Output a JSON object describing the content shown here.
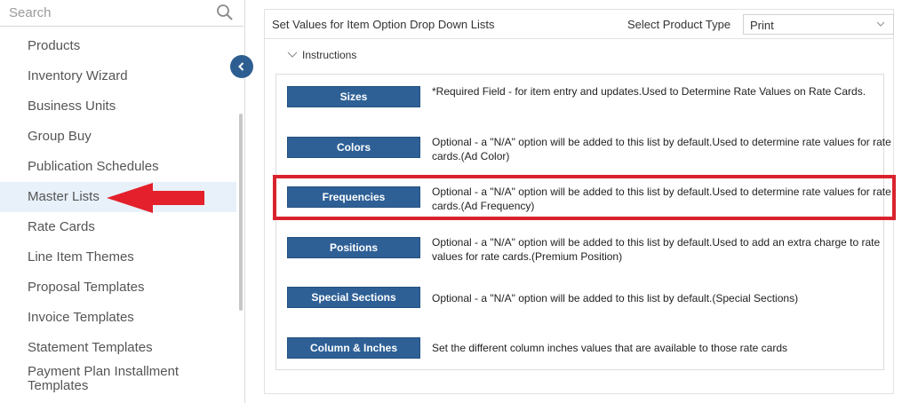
{
  "search": {
    "placeholder": "Search",
    "icon": "search-icon"
  },
  "sidebar": {
    "collapse_icon": "chevron-left-icon",
    "active_color": "#e8f1fa",
    "items": [
      {
        "label": "Products"
      },
      {
        "label": "Inventory Wizard"
      },
      {
        "label": "Business Units"
      },
      {
        "label": "Group Buy"
      },
      {
        "label": "Publication Schedules"
      },
      {
        "label": "Master Lists",
        "active": true
      },
      {
        "label": "Rate Cards"
      },
      {
        "label": "Line Item Themes"
      },
      {
        "label": "Proposal Templates"
      },
      {
        "label": "Invoice Templates"
      },
      {
        "label": "Statement Templates"
      },
      {
        "label": "Payment Plan Installment Templates"
      }
    ]
  },
  "annotation": {
    "arrow_color": "#e3202b",
    "highlight_color": "#d9232c"
  },
  "main": {
    "title": "Set Values for Item Option Drop Down Lists",
    "product_type_label": "Select Product Type",
    "product_type_value": "Print",
    "instructions_label": "Instructions",
    "button_color": "#2e6096",
    "rows": [
      {
        "button": "Sizes",
        "description": "*Required Field - for item entry and updates.Used to Determine Rate Values on Rate Cards."
      },
      {
        "button": "Colors",
        "description": "Optional - a \"N/A\" option will be added to this list by default.Used to determine rate values for rate cards.(Ad Color)"
      },
      {
        "button": "Frequencies",
        "description": "Optional - a \"N/A\" option will be added to this list by default.Used to determine rate values for rate cards.(Ad Frequency)"
      },
      {
        "button": "Positions",
        "description": "Optional - a \"N/A\" option will be added to this list by default.Used to add an extra charge to rate values for rate cards.(Premium Position)"
      },
      {
        "button": "Special Sections",
        "description": "Optional - a \"N/A\" option will be added to this list by default.(Special Sections)"
      },
      {
        "button": "Column & Inches",
        "description": "Set the different column inches values that are available to those rate cards"
      }
    ]
  }
}
